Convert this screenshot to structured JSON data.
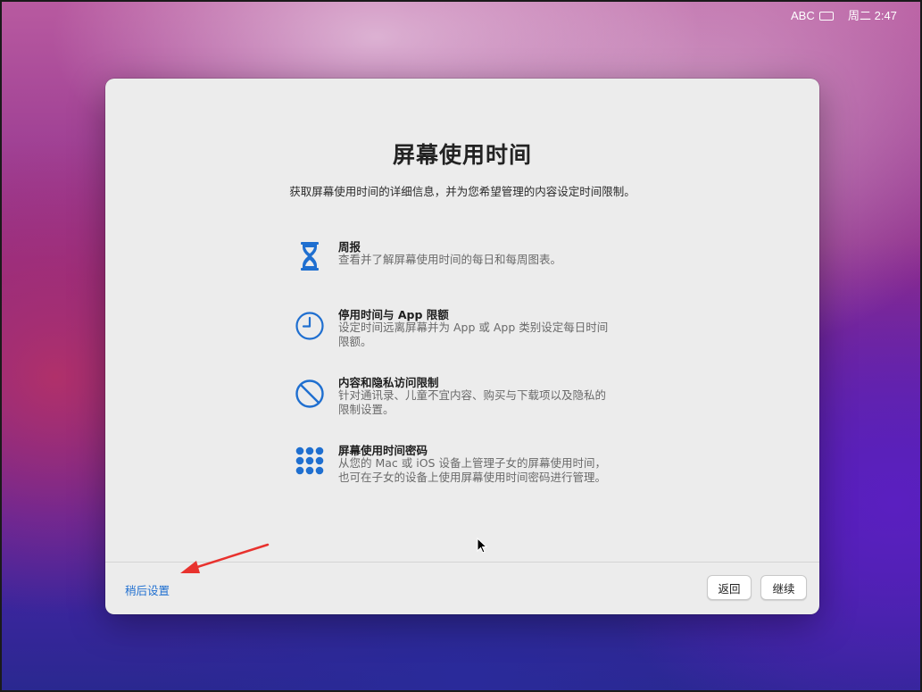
{
  "menubar": {
    "input_source": "ABC",
    "clock": "周二 2:47"
  },
  "dialog": {
    "title": "屏幕使用时间",
    "subtitle": "获取屏幕使用时间的详细信息，并为您希望管理的内容设定时间限制。",
    "features": [
      {
        "icon": "hourglass-icon",
        "title": "周报",
        "description": "查看并了解屏幕使用时间的每日和每周图表。"
      },
      {
        "icon": "clock-icon",
        "title": "停用时间与 App 限额",
        "description": "设定时间远离屏幕并为 App 或 App 类别设定每日时间限额。"
      },
      {
        "icon": "prohibited-icon",
        "title": "内容和隐私访问限制",
        "description": "针对通讯录、儿童不宜内容、购买与下载项以及隐私的限制设置。"
      },
      {
        "icon": "passcode-keypad-icon",
        "title": "屏幕使用时间密码",
        "description": "从您的 Mac 或 iOS 设备上管理子女的屏幕使用时间，也可在子女的设备上使用屏幕使用时间密码进行管理。"
      }
    ],
    "footer": {
      "set_up_later": "稍后设置",
      "back": "返回",
      "continue": "继续"
    }
  },
  "colors": {
    "accent": "#1f6fd0",
    "annotation_arrow": "#e8322e"
  }
}
